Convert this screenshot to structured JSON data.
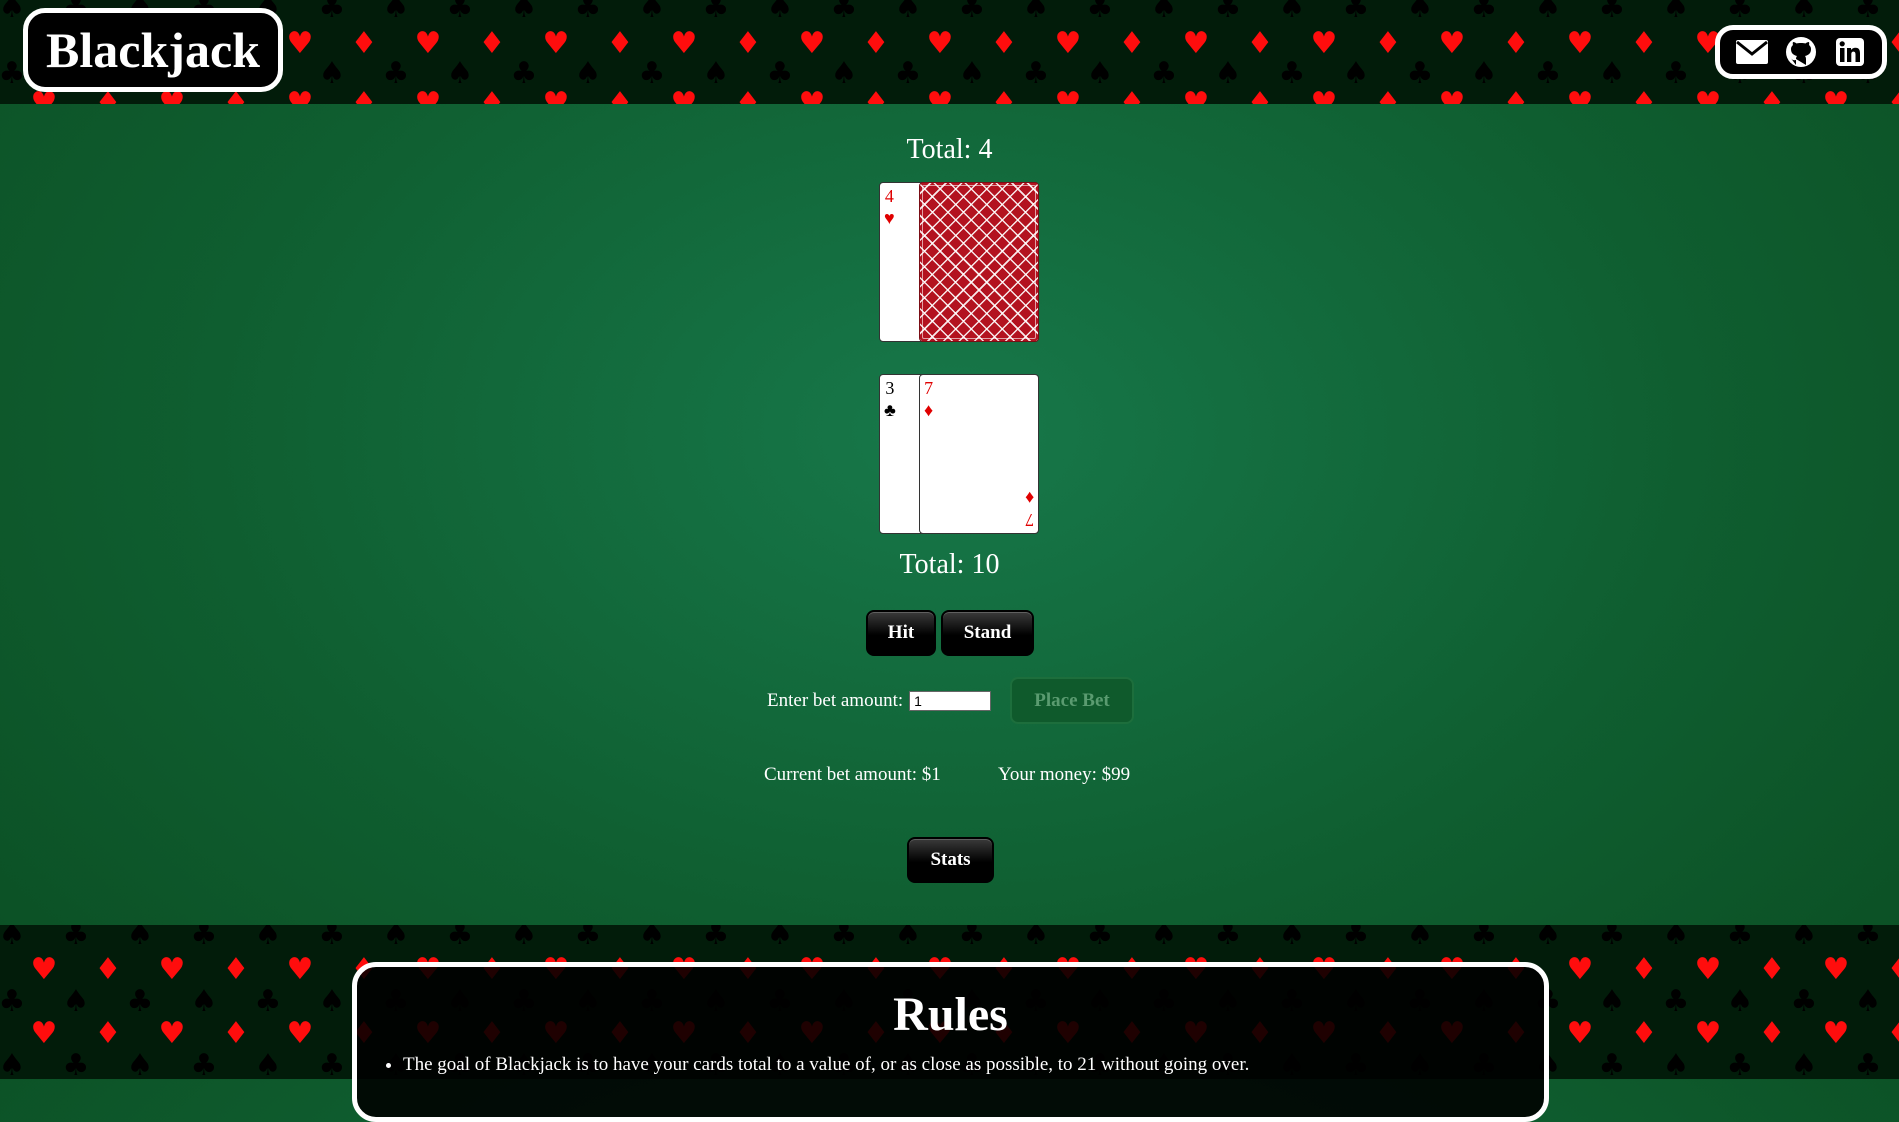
{
  "header": {
    "title": "Blackjack",
    "icons": [
      "envelope-icon",
      "github-icon",
      "linkedin-icon"
    ]
  },
  "dealer": {
    "total_label": "Total: 4",
    "cards": [
      {
        "rank": "4",
        "suit": "♥",
        "color": "#e00000"
      },
      {
        "face": "down"
      }
    ]
  },
  "player": {
    "total_label": "Total: 10",
    "cards": [
      {
        "rank": "3",
        "suit": "♣",
        "color": "#000000"
      },
      {
        "rank": "7",
        "suit": "♦",
        "color": "#e00000"
      }
    ]
  },
  "controls": {
    "hit_label": "Hit",
    "stand_label": "Stand",
    "bet_prompt": "Enter bet amount:",
    "bet_input_value": "1",
    "place_bet_label": "Place Bet",
    "current_bet_label": "Current bet amount: $1",
    "money_label": "Your money: $99",
    "stats_label": "Stats"
  },
  "rules": {
    "title": "Rules",
    "first_item": "The goal of Blackjack is to have your cards total to a value of, or as close as possible, to 21 without going over."
  },
  "colors": {
    "felt": "#14703f",
    "red_suit": "#ff0d0d",
    "card_back": "#b3121f"
  }
}
